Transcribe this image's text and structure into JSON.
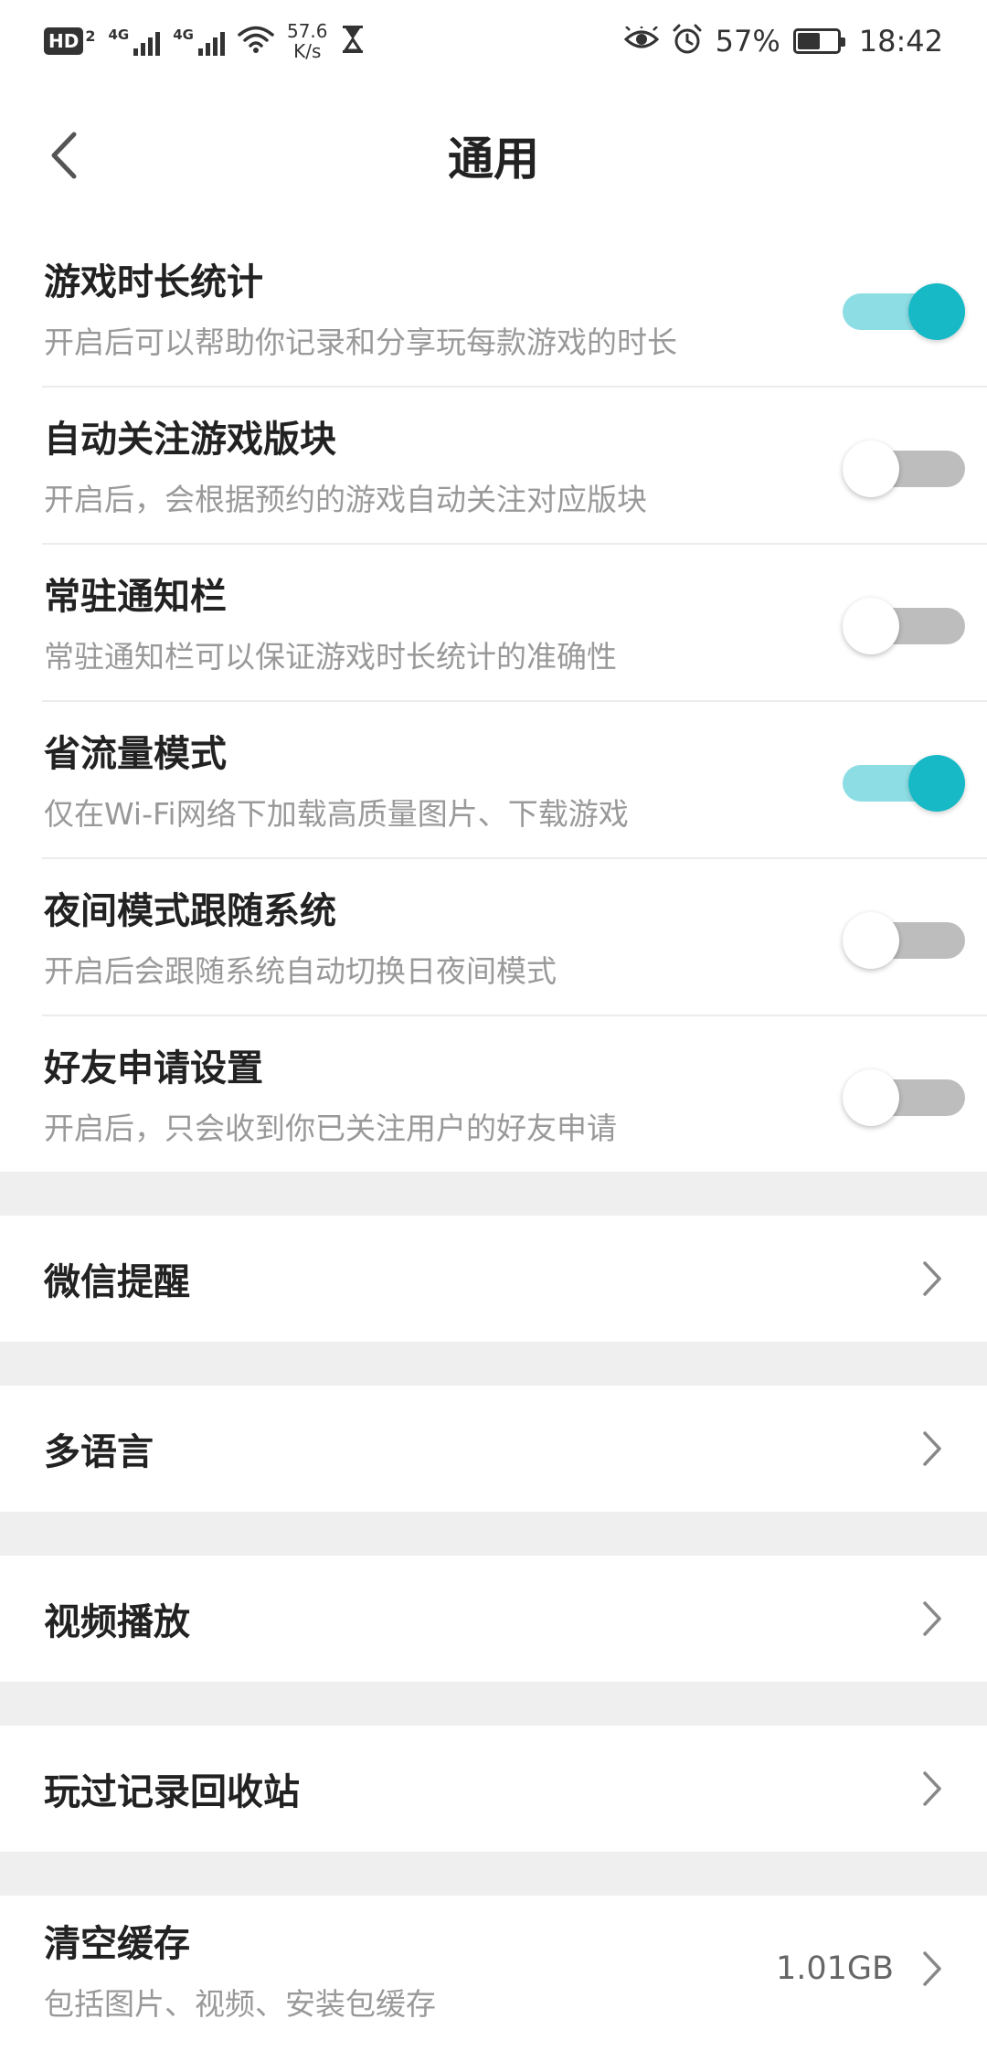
{
  "status_bar": {
    "hd_label": "HD",
    "hd_sub": "2",
    "signal1_label": "4G",
    "signal2_label": "4G",
    "speed_value": "57.6",
    "speed_unit": "K/s",
    "battery_percent": "57%",
    "battery_level": 0.57,
    "time": "18:42",
    "icons": [
      "hd-icon",
      "signal-icon",
      "signal-icon",
      "wifi-icon",
      "hourglass-icon",
      "eye-icon",
      "alarm-icon",
      "battery-icon"
    ]
  },
  "header": {
    "title": "通用",
    "back_icon": "chevron-left-icon"
  },
  "toggles": [
    {
      "title": "游戏时长统计",
      "desc": "开启后可以帮助你记录和分享玩每款游戏的时长",
      "on": true
    },
    {
      "title": "自动关注游戏版块",
      "desc": "开启后，会根据预约的游戏自动关注对应版块",
      "on": false
    },
    {
      "title": "常驻通知栏",
      "desc": "常驻通知栏可以保证游戏时长统计的准确性",
      "on": false
    },
    {
      "title": "省流量模式",
      "desc": "仅在Wi-Fi网络下加载高质量图片、下载游戏",
      "on": true
    },
    {
      "title": "夜间模式跟随系统",
      "desc": "开启后会跟随系统自动切换日夜间模式",
      "on": false
    },
    {
      "title": "好友申请设置",
      "desc": "开启后，只会收到你已关注用户的好友申请",
      "on": false
    }
  ],
  "nav_items": [
    {
      "title": "微信提醒"
    },
    {
      "title": "多语言"
    },
    {
      "title": "视频播放"
    },
    {
      "title": "玩过记录回收站"
    }
  ],
  "cache": {
    "title": "清空缓存",
    "desc": "包括图片、视频、安装包缓存",
    "value": "1.01GB"
  },
  "colors": {
    "accent": "#16b9c5",
    "accent_track": "#8ddde4",
    "off_track": "#bdbdbd",
    "separator": "#efefef"
  }
}
